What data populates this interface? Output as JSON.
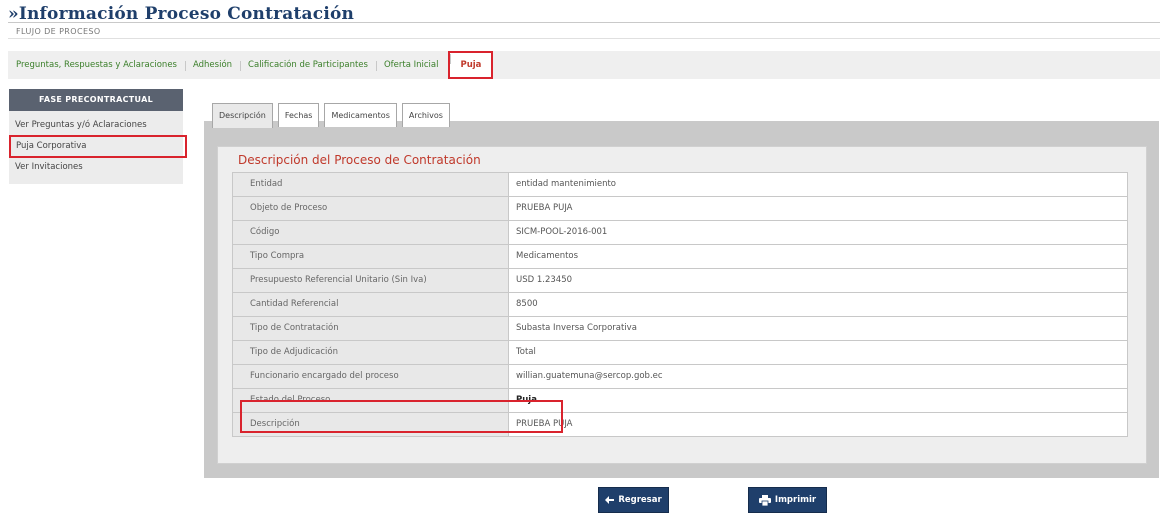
{
  "header": {
    "title": "»Información Proceso Contratación",
    "subtitle": "FLUJO DE PROCESO"
  },
  "top_tabs": [
    {
      "label": "Preguntas, Respuestas y Aclaraciones"
    },
    {
      "label": "Adhesión"
    },
    {
      "label": "Calificación de Participantes"
    },
    {
      "label": "Oferta Inicial"
    },
    {
      "label": "Puja",
      "active": true
    }
  ],
  "sidebar": {
    "header": "FASE PRECONTRACTUAL",
    "items": [
      {
        "label": "Ver Preguntas y/ó Aclaraciones"
      },
      {
        "label": "Puja Corporativa",
        "selected": true
      },
      {
        "label": "Ver Invitaciones"
      }
    ]
  },
  "inner_tabs": [
    {
      "label": "Descripción",
      "active": true
    },
    {
      "label": "Fechas"
    },
    {
      "label": "Medicamentos"
    },
    {
      "label": "Archivos"
    }
  ],
  "section": {
    "title": "Descripción del Proceso de Contratación"
  },
  "details": [
    {
      "label": "Entidad",
      "value": "entidad mantenimiento"
    },
    {
      "label": "Objeto de Proceso",
      "value": "PRUEBA PUJA"
    },
    {
      "label": "Código",
      "value": "SICM-POOL-2016-001"
    },
    {
      "label": "Tipo Compra",
      "value": "Medicamentos"
    },
    {
      "label": "Presupuesto Referencial Unitario (Sin Iva)",
      "value": "USD 1.23450"
    },
    {
      "label": "Cantidad Referencial",
      "value": "8500"
    },
    {
      "label": "Tipo de Contratación",
      "value": "Subasta Inversa Corporativa"
    },
    {
      "label": "Tipo de Adjudicación",
      "value": "Total"
    },
    {
      "label": "Funcionario encargado del proceso",
      "value": "willian.guatemuna@sercop.gob.ec"
    },
    {
      "label": "Estado del Proceso",
      "value": "Puja",
      "emphasis": true
    },
    {
      "label": "Descripción",
      "value": "PRUEBA PUJA"
    }
  ],
  "buttons": {
    "back_label": "Regresar",
    "print_label": "Imprimir"
  },
  "colors": {
    "brand": "#1f3f6b",
    "highlight": "#d9232d",
    "tab_text": "#3b7f2a",
    "section_title": "#c0392b",
    "sidebar_header": "#5a6270"
  }
}
